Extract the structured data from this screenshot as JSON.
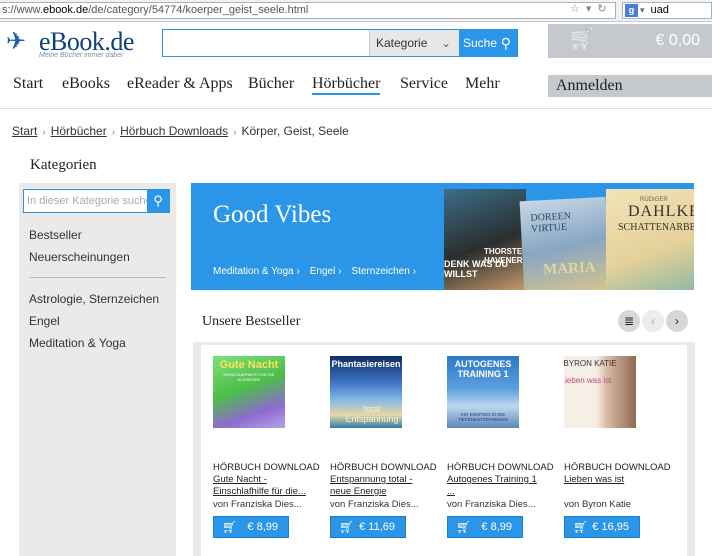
{
  "browser": {
    "url_prefix": "s://www.",
    "url_domain": "ebook.de",
    "url_path": "/de/category/54774/koerper_geist_seele.html",
    "search_value": "uad"
  },
  "header": {
    "logo_text": "eBook.de",
    "logo_tagline": "Meine Bücher immer dabei",
    "search_placeholder": "",
    "search_category": "Kategorie",
    "search_button": "Suche",
    "cart_count": "0",
    "cart_total": "€ 0,00",
    "login": "Anmelden"
  },
  "nav": {
    "items": [
      "Start",
      "eBooks",
      "eReader & Apps",
      "Bücher",
      "Hörbücher",
      "Service",
      "Mehr"
    ],
    "active": "Hörbücher"
  },
  "breadcrumb": {
    "items": [
      "Start",
      "Hörbücher",
      "Hörbuch Downloads"
    ],
    "current": "Körper, Geist, Seele"
  },
  "sidebar": {
    "title": "Kategorien",
    "search_placeholder": "In dieser Kategorie suchen",
    "links_top": [
      "Bestseller",
      "Neuerscheinungen"
    ],
    "links_bottom": [
      "Astrologie, Sternzeichen",
      "Engel",
      "Meditation & Yoga"
    ]
  },
  "promo": {
    "title": "Good Vibes",
    "links": [
      "Meditation & Yoga",
      "Engel",
      "Sternzeichen"
    ],
    "covers": [
      {
        "line1": "THORSTEN HAVENER",
        "line2": "DENK WAS DU WILLST"
      },
      {
        "line1": "DOREEN VIRTUE",
        "line2": "MARIA"
      },
      {
        "line0": "RÜDIGER",
        "line1": "DAHLKE",
        "line2": "SCHATTENARBEIT"
      }
    ]
  },
  "bestseller": {
    "title": "Unsere Bestseller",
    "products": [
      {
        "type": "HÖRBUCH DOWNLOAD",
        "title": "Gute Nacht - Einschlafhilfe für die...",
        "author": "von Franziska Dies...",
        "price": "€ 8,99",
        "cover_title": "Gute Nacht",
        "cover_sub": "EINSCHLAFHILFE FÜR DIE KLEINSTEN"
      },
      {
        "type": "HÖRBUCH DOWNLOAD",
        "title": "Entspannung total - neue Energie",
        "author": "von Franziska Dies...",
        "price": "€ 11,69",
        "cover_title": "Phantasiereisen",
        "cover_sub": "total Entspannung"
      },
      {
        "type": "HÖRBUCH DOWNLOAD",
        "title": "Autogenes Training 1 ...",
        "author": "von Franziska Dies...",
        "price": "€ 8,99",
        "cover_title": "AUTOGENES TRAINING 1",
        "cover_sub": "IHR EINSTIEG IN DIE TIEFENENTSPANNUNG"
      },
      {
        "type": "HÖRBUCH DOWNLOAD",
        "title": "Lieben was ist",
        "author": "von Byron Katie",
        "price": "€ 16,95",
        "cover_title": "BYRON KATIE",
        "cover_sub": "Lieben was ist"
      }
    ]
  },
  "colors": {
    "accent_blue": "#2b96e8",
    "logo_blue": "#0f3f7f",
    "cart_gray": "#c5c9cd",
    "sidebar_gray": "#eaeaea"
  },
  "icons": {
    "search": "magnifier-icon",
    "cart": "shopping-cart-icon",
    "list_view": "list-view-icon",
    "prev": "chevron-left-icon",
    "next": "chevron-right-icon"
  }
}
